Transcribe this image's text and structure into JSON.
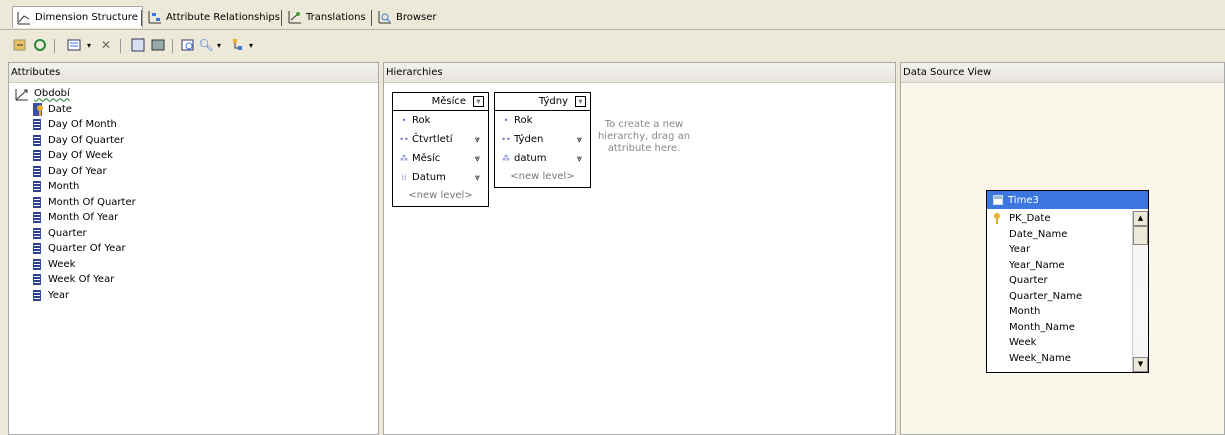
{
  "tabs": [
    {
      "label": "Dimension Structure",
      "icon": "dimension-structure-icon"
    },
    {
      "label": "Attribute Relationships",
      "icon": "attribute-relationships-icon"
    },
    {
      "label": "Translations",
      "icon": "translations-icon"
    },
    {
      "label": "Browser",
      "icon": "browser-icon"
    }
  ],
  "panes": {
    "attributes": "Attributes",
    "hierarchies": "Hierarchies",
    "dsv": "Data Source View"
  },
  "dimension": {
    "name": "Období",
    "key_attribute": "Date",
    "attributes": [
      "Day Of Month",
      "Day Of Quarter",
      "Day Of Week",
      "Day Of Year",
      "Month",
      "Month Of Quarter",
      "Month Of Year",
      "Quarter",
      "Quarter Of Year",
      "Week",
      "Week Of Year",
      "Year"
    ]
  },
  "hierarchies": [
    {
      "name": "Měsíce",
      "levels": [
        "Rok",
        "Čtvrtletí",
        "Měsíc",
        "Datum"
      ],
      "new_level": "<new level>"
    },
    {
      "name": "Týdny",
      "levels": [
        "Rok",
        "Týden",
        "datum"
      ],
      "new_level": "<new level>"
    }
  ],
  "hint": "To create a new hierarchy, drag an attribute here.",
  "table": {
    "name": "Time3",
    "columns": [
      "PK_Date",
      "Date_Name",
      "Year",
      "Year_Name",
      "Quarter",
      "Quarter_Name",
      "Month",
      "Month_Name",
      "Week",
      "Week_Name"
    ]
  },
  "colors": {
    "accent": "#3c77e0",
    "dsv_bg": "#fbf6ea"
  }
}
